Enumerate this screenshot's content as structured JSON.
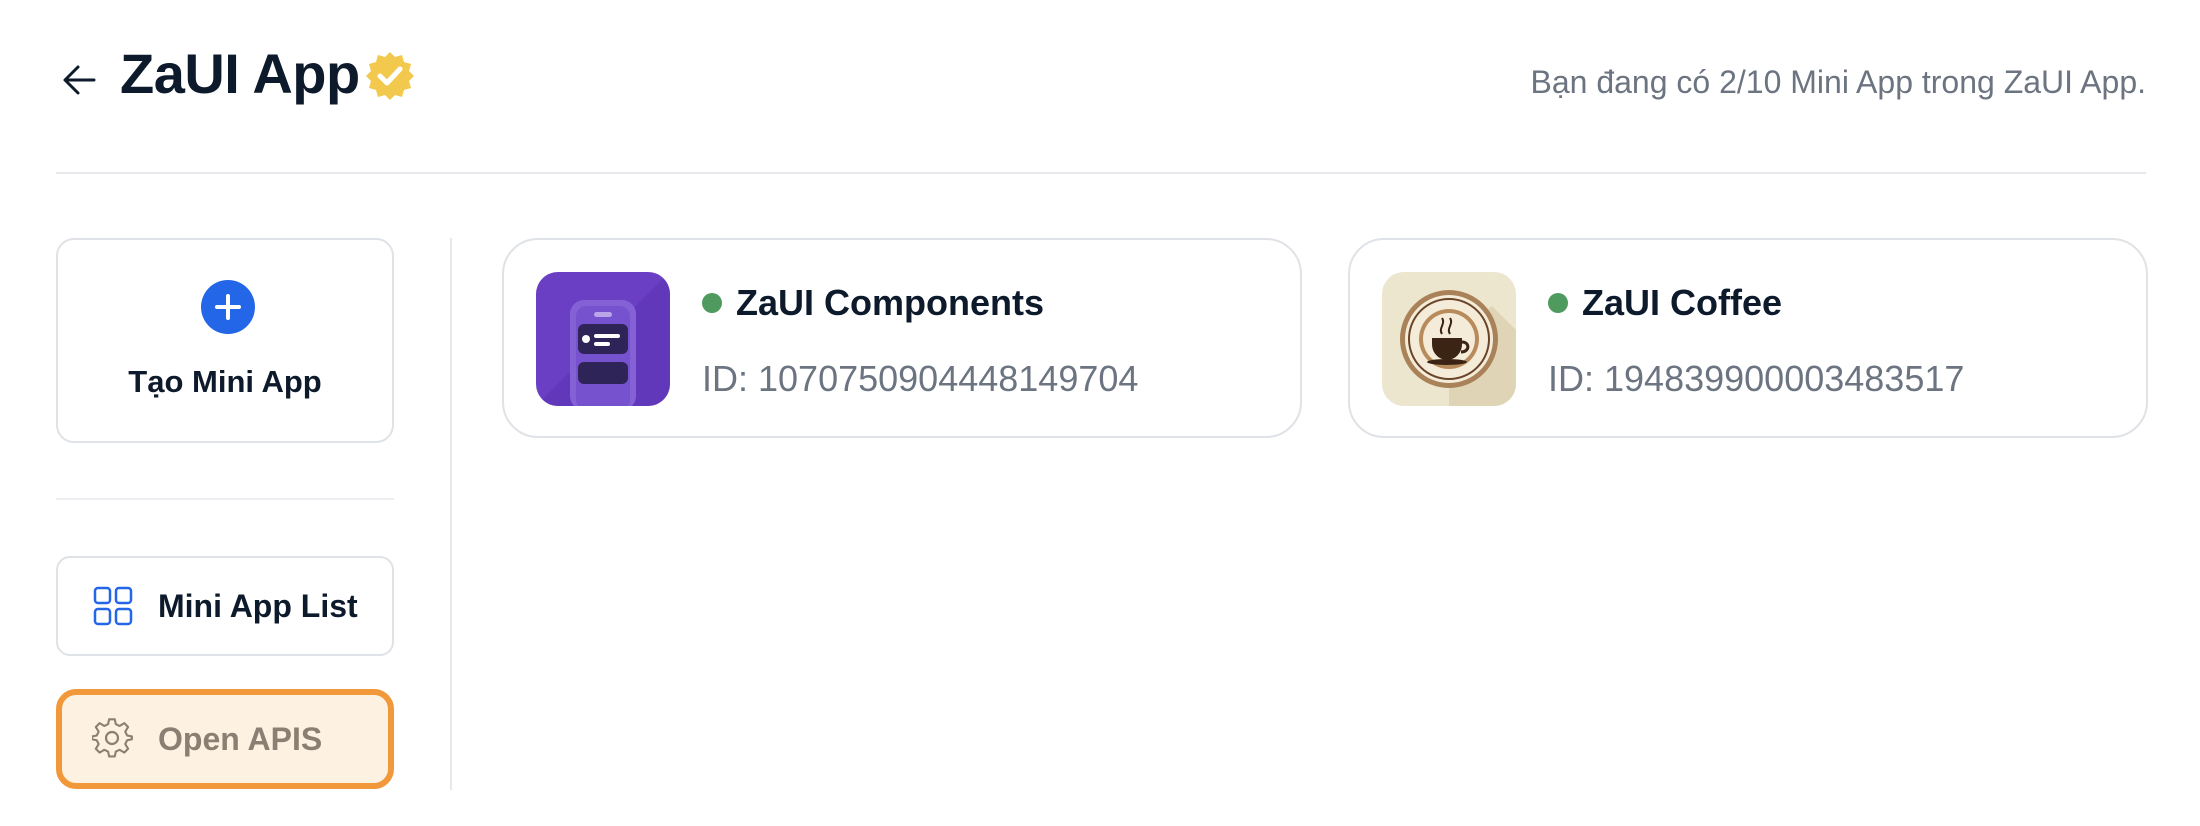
{
  "header": {
    "title": "ZaUI App",
    "quota_text": "Bạn đang có 2/10 Mini App trong ZaUI App."
  },
  "sidebar": {
    "create_label": "Tạo Mini App",
    "items": [
      {
        "label": "Mini App List",
        "icon": "grid-icon",
        "active": false
      },
      {
        "label": "Open APIS",
        "icon": "gear-icon",
        "active": true
      }
    ]
  },
  "apps": [
    {
      "name": "ZaUI Components",
      "id_text": "ID: 1070750904448149704",
      "status": "online",
      "icon": "components-app-icon"
    },
    {
      "name": "ZaUI Coffee",
      "id_text": "ID: 194839900003483517",
      "status": "online",
      "icon": "coffee-app-icon"
    }
  ],
  "colors": {
    "accent_blue": "#2466e8",
    "status_green": "#4f9a5e",
    "verified_gold": "#f2c94c",
    "highlight_orange": "#f0983a"
  }
}
